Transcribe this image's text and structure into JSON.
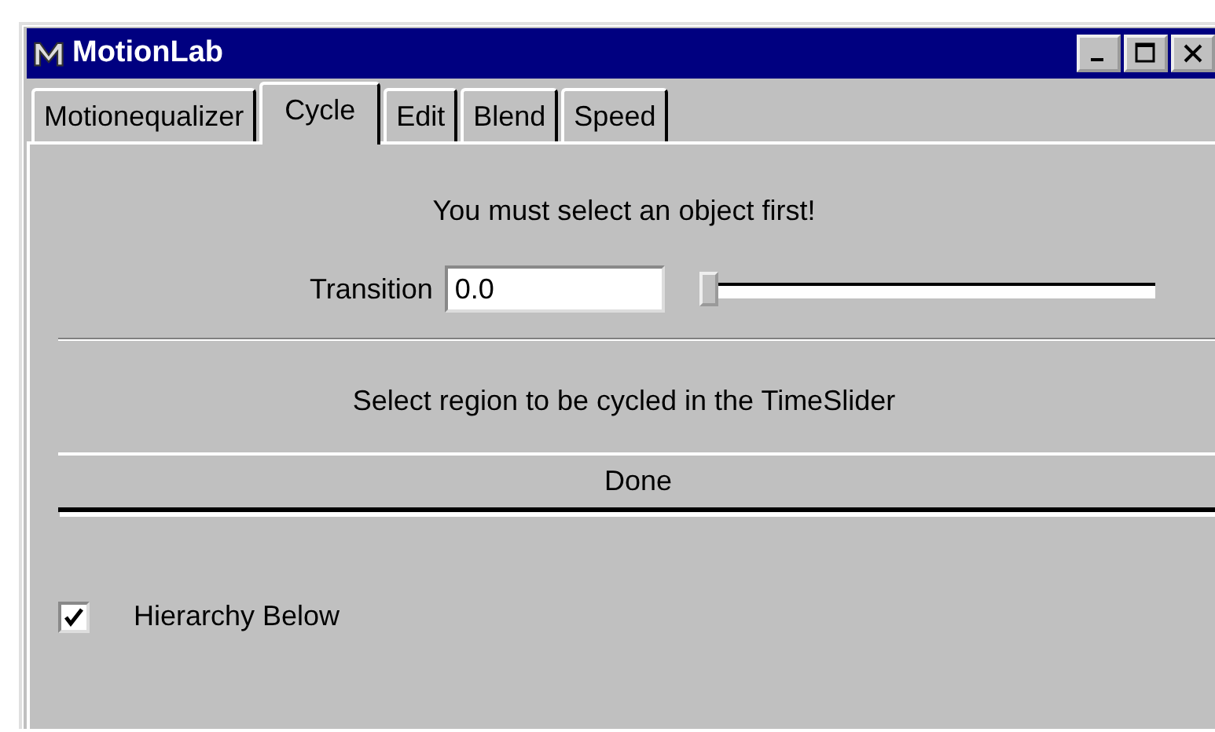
{
  "window": {
    "title": "MotionLab"
  },
  "tabs": [
    {
      "label": "Motionequalizer",
      "selected": false
    },
    {
      "label": "Cycle",
      "selected": true
    },
    {
      "label": "Edit",
      "selected": false
    },
    {
      "label": "Blend",
      "selected": false
    },
    {
      "label": "Speed",
      "selected": false
    }
  ],
  "message": "You must select an object first!",
  "transition": {
    "label": "Transition",
    "value": "0.0",
    "level": 0
  },
  "instruction": "Select region to be cycled in the TimeSlider",
  "done_button": "Done",
  "hierarchy_below": {
    "label": "Hierarchy Below",
    "checked": true
  }
}
